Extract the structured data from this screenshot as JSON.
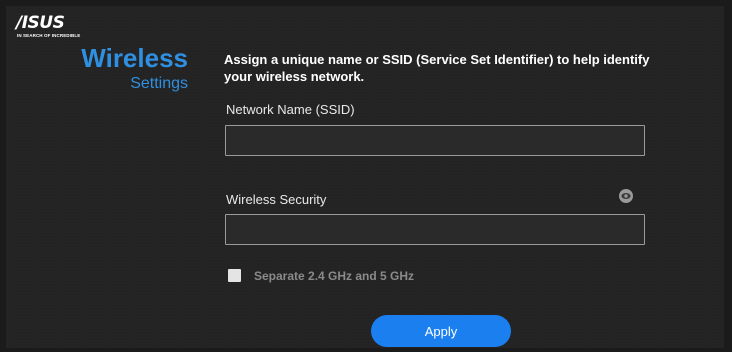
{
  "brand": {
    "name": "/ISUS",
    "tagline": "IN SEARCH OF INCREDIBLE"
  },
  "header": {
    "title": "Wireless",
    "subtitle": "Settings"
  },
  "instruction": "Assign a unique name or SSID (Service Set Identifier) to help identify your wireless network.",
  "form": {
    "ssid_label": "Network Name (SSID)",
    "ssid_value": "",
    "security_label": "Wireless Security",
    "security_value": "",
    "separate_bands_label": "Separate 2.4 GHz and 5 GHz",
    "separate_bands_checked": false,
    "apply_label": "Apply"
  },
  "icons": {
    "password_toggle": "eye-icon"
  },
  "colors": {
    "accent": "#2f8fe0",
    "button": "#1b7ff0",
    "background": "#232323"
  }
}
